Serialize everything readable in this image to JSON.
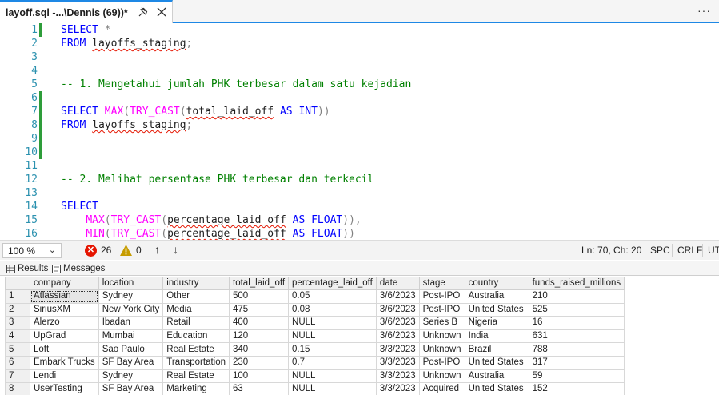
{
  "tab": {
    "title": "layoff.sql -...\\Dennis (69))*",
    "overflow": "···"
  },
  "editor": {
    "lines": [
      {
        "n": "1",
        "tokens": [
          [
            "kw",
            "SELECT "
          ],
          [
            "gy",
            "*"
          ]
        ]
      },
      {
        "n": "2",
        "tokens": [
          [
            "kw",
            "FROM "
          ],
          [
            "sq",
            "layoffs_staging"
          ],
          [
            "gy",
            ";"
          ]
        ]
      },
      {
        "n": "3",
        "tokens": []
      },
      {
        "n": "4",
        "tokens": []
      },
      {
        "n": "5",
        "tokens": [
          [
            "cm",
            "-- 1. Mengetahui jumlah PHK terbesar dalam satu kejadian"
          ]
        ]
      },
      {
        "n": "6",
        "tokens": []
      },
      {
        "n": "7",
        "tokens": [
          [
            "kw",
            "SELECT "
          ],
          [
            "fn",
            "MAX"
          ],
          [
            "gy",
            "("
          ],
          [
            "fn",
            "TRY_CAST"
          ],
          [
            "gy",
            "("
          ],
          [
            "sq",
            "total_laid_off"
          ],
          [
            "kw",
            " AS INT"
          ],
          [
            "gy",
            "))"
          ]
        ]
      },
      {
        "n": "8",
        "tokens": [
          [
            "kw",
            "FROM "
          ],
          [
            "sq",
            "layoffs_staging"
          ],
          [
            "gy",
            ";"
          ]
        ]
      },
      {
        "n": "9",
        "tokens": []
      },
      {
        "n": "10",
        "tokens": []
      },
      {
        "n": "11",
        "tokens": []
      },
      {
        "n": "12",
        "tokens": [
          [
            "cm",
            "-- 2. Melihat persentase PHK terbesar dan terkecil"
          ]
        ]
      },
      {
        "n": "13",
        "tokens": []
      },
      {
        "n": "14",
        "tokens": [
          [
            "kw",
            "SELECT"
          ]
        ]
      },
      {
        "n": "15",
        "tokens": [
          [
            "pl",
            "    "
          ],
          [
            "fn",
            "MAX"
          ],
          [
            "gy",
            "("
          ],
          [
            "fn",
            "TRY_CAST"
          ],
          [
            "gy",
            "("
          ],
          [
            "sq",
            "percentage_laid_off"
          ],
          [
            "kw",
            " AS FLOAT"
          ],
          [
            "gy",
            ")),"
          ]
        ]
      },
      {
        "n": "16",
        "tokens": [
          [
            "pl",
            "    "
          ],
          [
            "fn",
            "MIN"
          ],
          [
            "gy",
            "("
          ],
          [
            "fn",
            "TRY_CAST"
          ],
          [
            "gy",
            "("
          ],
          [
            "sq",
            "percentage_laid_off"
          ],
          [
            "kw",
            " AS FLOAT"
          ],
          [
            "gy",
            "))"
          ]
        ]
      }
    ]
  },
  "status": {
    "zoom": "100 %",
    "errors": "26",
    "warnings": "0",
    "position": "Ln: 70, Ch: 20",
    "encoding": "SPC",
    "eol": "CRLF",
    "tabs": "UT"
  },
  "results_tabs": {
    "results": "Results",
    "messages": "Messages"
  },
  "grid": {
    "columns": [
      "company",
      "location",
      "industry",
      "total_laid_off",
      "percentage_laid_off",
      "date",
      "stage",
      "country",
      "funds_raised_millions"
    ],
    "rows": [
      [
        "1",
        "Atlassian",
        "Sydney",
        "Other",
        "500",
        "0.05",
        "3/6/2023",
        "Post-IPO",
        "Australia",
        "210"
      ],
      [
        "2",
        "SiriusXM",
        "New York City",
        "Media",
        "475",
        "0.08",
        "3/6/2023",
        "Post-IPO",
        "United States",
        "525"
      ],
      [
        "3",
        "Alerzo",
        "Ibadan",
        "Retail",
        "400",
        "NULL",
        "3/6/2023",
        "Series B",
        "Nigeria",
        "16"
      ],
      [
        "4",
        "UpGrad",
        "Mumbai",
        "Education",
        "120",
        "NULL",
        "3/6/2023",
        "Unknown",
        "India",
        "631"
      ],
      [
        "5",
        "Loft",
        "Sao Paulo",
        "Real Estate",
        "340",
        "0.15",
        "3/3/2023",
        "Unknown",
        "Brazil",
        "788"
      ],
      [
        "6",
        "Embark Trucks",
        "SF Bay Area",
        "Transportation",
        "230",
        "0.7",
        "3/3/2023",
        "Post-IPO",
        "United States",
        "317"
      ],
      [
        "7",
        "Lendi",
        "Sydney",
        "Real Estate",
        "100",
        "NULL",
        "3/3/2023",
        "Unknown",
        "Australia",
        "59"
      ],
      [
        "8",
        "UserTesting",
        "SF Bay Area",
        "Marketing",
        "63",
        "NULL",
        "3/3/2023",
        "Acquired",
        "United States",
        "152"
      ]
    ]
  },
  "colors": {
    "accent": "#1e88e5",
    "change_bar": "#2e9d3a",
    "error": "#e51400",
    "warning": "#c69c00"
  }
}
